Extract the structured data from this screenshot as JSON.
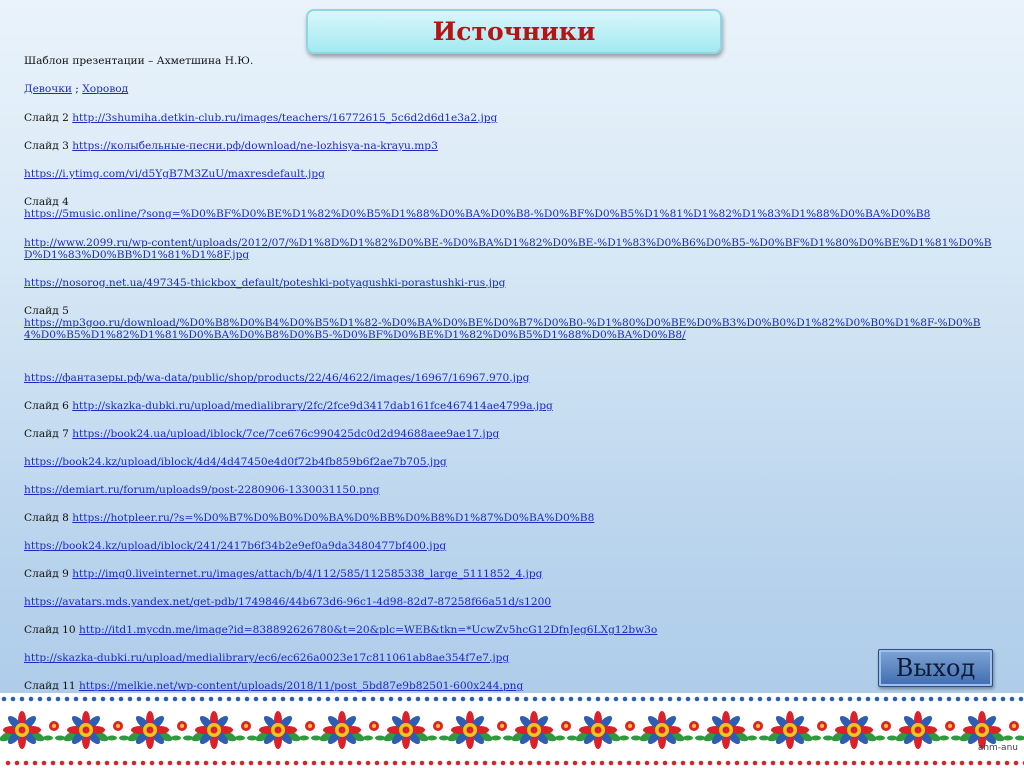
{
  "title": "Источники",
  "lines": [
    {
      "label": "Шаблон презентации – Ахметшина Н.Ю.",
      "links": []
    },
    {
      "label": "",
      "links": [
        {
          "text": "Девочки"
        },
        {
          "sep": " ; "
        },
        {
          "text": "Хоровод"
        }
      ]
    },
    {
      "label": "Слайд 2 ",
      "links": [
        {
          "text": "http://3shumiha.detkin-club.ru/images/teachers/16772615_5c6d2d6d1e3a2.jpg"
        }
      ]
    },
    {
      "label": "Слайд 3 ",
      "links": [
        {
          "text": "https://колыбельные-песни.рф/download/ne-lozhisya-na-krayu.mp3"
        }
      ]
    },
    {
      "label": "",
      "links": [
        {
          "text": "https://i.ytimg.com/vi/d5YgB7M3ZuU/maxresdefault.jpg"
        }
      ]
    },
    {
      "label": "Слайд 4",
      "links": []
    },
    {
      "label": "",
      "links": [
        {
          "text": "https://5music.online/?song=%D0%BF%D0%BE%D1%82%D0%B5%D1%88%D0%BA%D0%B8-%D0%BF%D0%B5%D1%81%D1%82%D1%83%D1%88%D0%BA%D0%B8"
        }
      ]
    },
    {
      "label": "",
      "links": [
        {
          "text": "http://www.2099.ru/wp-content/uploads/2012/07/%D1%8D%D1%82%D0%BE-%D0%BA%D1%82%D0%BE-%D1%83%D0%B6%D0%B5-%D0%BF%D1%80%D0%BE%D1%81%D0%BD%D1%83%D0%BB%D1%81%D1%8F.jpg"
        }
      ]
    },
    {
      "label": "",
      "links": [
        {
          "text": "https://nosorog.net.ua/497345-thickbox_default/poteshki-potyagushki-porastushki-rus.jpg"
        }
      ]
    },
    {
      "label": "Слайд 5",
      "links": []
    },
    {
      "label": "",
      "links": [
        {
          "text": "https://mp3goo.ru/download/%D0%B8%D0%B4%D0%B5%D1%82-%D0%BA%D0%BE%D0%B7%D0%B0-%D1%80%D0%BE%D0%B3%D0%B0%D1%82%D0%B0%D1%8F-%D0%B4%D0%B5%D1%82%D1%81%D0%BA%D0%B8%D0%B5-%D0%BF%D0%BE%D1%82%D0%B5%D1%88%D0%BA%D0%B8/"
        }
      ]
    },
    {
      "label": "",
      "links": [
        {
          "text": "https://фантазеры.рф/wa-data/public/shop/products/22/46/4622/images/16967/16967.970.jpg"
        }
      ]
    },
    {
      "label": "Слайд 6 ",
      "links": [
        {
          "text": "http://skazka-dubki.ru/upload/medialibrary/2fc/2fce9d3417dab161fce467414ae4799a.jpg"
        }
      ]
    },
    {
      "label": "Слайд 7 ",
      "links": [
        {
          "text": "https://book24.ua/upload/iblock/7ce/7ce676c990425dc0d2d94688aee9ae17.jpg"
        }
      ]
    },
    {
      "label": "",
      "links": [
        {
          "text": "https://book24.kz/upload/iblock/4d4/4d47450e4d0f72b4fb859b6f2ae7b705.jpg"
        }
      ]
    },
    {
      "label": "",
      "links": [
        {
          "text": "https://demiart.ru/forum/uploads9/post-2280906-1330031150.png"
        }
      ]
    },
    {
      "label": "Слайд 8 ",
      "links": [
        {
          "text": "https://hotpleer.ru/?s=%D0%B7%D0%B0%D0%BA%D0%BB%D0%B8%D1%87%D0%BA%D0%B8"
        }
      ]
    },
    {
      "label": "",
      "links": [
        {
          "text": "https://book24.kz/upload/iblock/241/2417b6f34b2e9ef0a9da3480477bf400.jpg"
        }
      ]
    },
    {
      "label": "Слайд 9 ",
      "links": [
        {
          "text": "http://img0.liveinternet.ru/images/attach/b/4/112/585/112585338_large_5111852_4.jpg"
        }
      ]
    },
    {
      "label": "",
      "links": [
        {
          "text": "https://avatars.mds.yandex.net/get-pdb/1749846/44b673d6-96c1-4d98-82d7-87258f66a51d/s1200"
        }
      ]
    },
    {
      "label": "Слайд 10 ",
      "links": [
        {
          "text": "http://itd1.mycdn.me/image?id=838892626780&t=20&plc=WEB&tkn=*UcwZv5hcG12DfnJeg6LXg12bw3o"
        }
      ]
    },
    {
      "label": "",
      "links": [
        {
          "text": "http://skazka-dubki.ru/upload/medialibrary/ec6/ec626a0023e17c811061ab8ae354f7e7.jpg"
        }
      ]
    },
    {
      "label": "Слайд 11 ",
      "links": [
        {
          "text": "https://melkie.net/wp-content/uploads/2018/11/post_5bd87e9b82501-600x244.png"
        }
      ]
    }
  ],
  "exit_button": "Выход",
  "footer_note": "ahm-anu",
  "colors": {
    "title_text": "#b81313",
    "title_bg": "#a4e9f2",
    "link": "#1a2bbf",
    "button_bg": "#3f6cae",
    "ornament_red": "#d8232a",
    "ornament_blue": "#2c5fb0",
    "ornament_green": "#2f9a3d",
    "ornament_yellow": "#f2c318"
  }
}
